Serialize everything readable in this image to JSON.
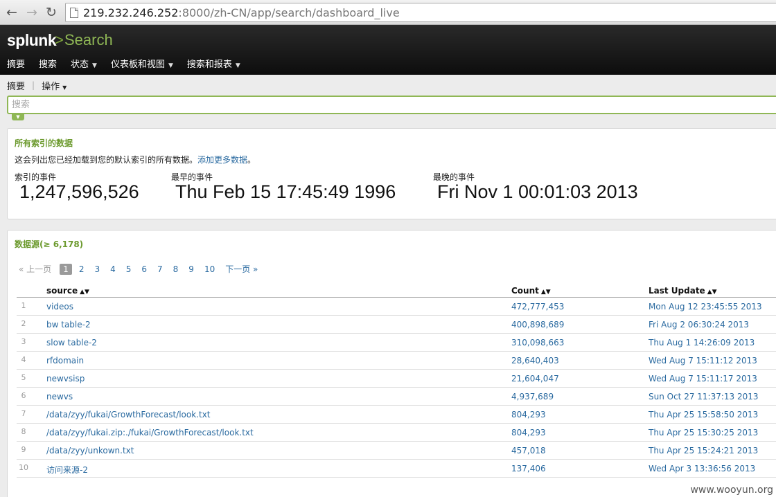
{
  "browser": {
    "url_host": "219.232.246.252",
    "url_rest": ":8000/zh-CN/app/search/dashboard_live"
  },
  "header": {
    "logo": "splunk",
    "logo_arrow": ">",
    "app_name": "Search",
    "menu": [
      {
        "label": "摘要",
        "dropdown": false
      },
      {
        "label": "搜索",
        "dropdown": false
      },
      {
        "label": "状态",
        "dropdown": true
      },
      {
        "label": "仪表板和视图",
        "dropdown": true
      },
      {
        "label": "搜索和报表",
        "dropdown": true
      }
    ]
  },
  "subnav": {
    "summary": "摘要",
    "sep": "|",
    "actions": "操作"
  },
  "search": {
    "placeholder": "搜索"
  },
  "summary_panel": {
    "title": "所有索引的数据",
    "description": "这会列出您已经加载到您的默认索引的所有数据。",
    "add_more_link": "添加更多数据",
    "description_end": "。",
    "stats": [
      {
        "label": "索引的事件",
        "value": "1,247,596,526"
      },
      {
        "label": "最早的事件",
        "value": "Thu Feb 15 17:45:49 1996"
      },
      {
        "label": "最晚的事件",
        "value": "Fri Nov 1 00:01:03 2013"
      }
    ]
  },
  "sources_panel": {
    "title": "数据源(≥ 6,178)",
    "pager": {
      "prev": "« 上一页",
      "pages": [
        "1",
        "2",
        "3",
        "4",
        "5",
        "6",
        "7",
        "8",
        "9",
        "10"
      ],
      "active": "1",
      "next": "下一页 »"
    },
    "columns": [
      "source",
      "Count",
      "Last Update"
    ],
    "rows": [
      {
        "idx": "1",
        "source": "videos",
        "count": "472,777,453",
        "last_update": "Mon Aug 12 23:45:55 2013"
      },
      {
        "idx": "2",
        "source": "bw table-2",
        "count": "400,898,689",
        "last_update": "Fri Aug 2 06:30:24 2013"
      },
      {
        "idx": "3",
        "source": "slow table-2",
        "count": "310,098,663",
        "last_update": "Thu Aug 1 14:26:09 2013"
      },
      {
        "idx": "4",
        "source": "rfdomain",
        "count": "28,640,403",
        "last_update": "Wed Aug 7 15:11:12 2013"
      },
      {
        "idx": "5",
        "source": "newvsisp",
        "count": "21,604,047",
        "last_update": "Wed Aug 7 15:11:17 2013"
      },
      {
        "idx": "6",
        "source": "newvs",
        "count": "4,937,689",
        "last_update": "Sun Oct 27 11:37:13 2013"
      },
      {
        "idx": "7",
        "source": "/data/zyy/fukai/GrowthForecast/look.txt",
        "count": "804,293",
        "last_update": "Thu Apr 25 15:58:50 2013"
      },
      {
        "idx": "8",
        "source": "/data/zyy/fukai.zip:./fukai/GrowthForecast/look.txt",
        "count": "804,293",
        "last_update": "Thu Apr 25 15:30:25 2013"
      },
      {
        "idx": "9",
        "source": "/data/zyy/unkown.txt",
        "count": "457,018",
        "last_update": "Thu Apr 25 15:24:21 2013"
      },
      {
        "idx": "10",
        "source": "访问来源-2",
        "count": "137,406",
        "last_update": "Wed Apr 3 13:36:56 2013"
      }
    ]
  },
  "watermark": "www.wooyun.org"
}
